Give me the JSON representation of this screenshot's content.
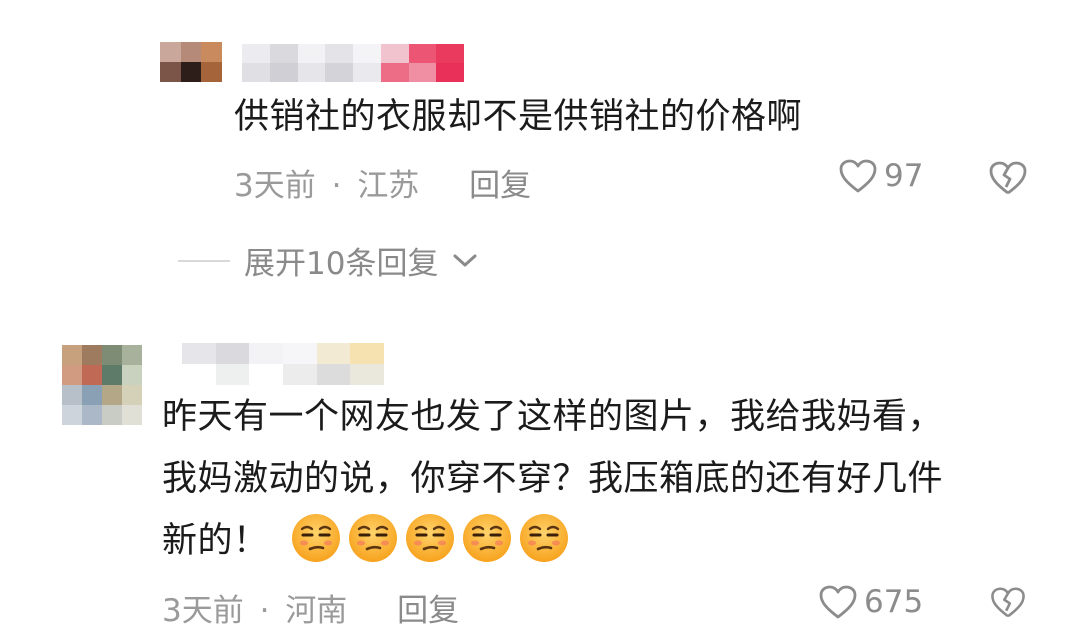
{
  "comments": [
    {
      "text_lines": [
        "供销社的衣服却不是供销社的价格啊"
      ],
      "time": "3天前",
      "separator": "·",
      "location": "江苏",
      "reply_label": "回复",
      "like_count": "97",
      "expand_replies_label": "展开10条回复"
    },
    {
      "text_lines": [
        "昨天有一个网友也发了这样的图片，我给我妈看，",
        "我妈激动的说，你穿不穿？我压箱底的还有好几件",
        "新的！"
      ],
      "emoji_count": 5,
      "time": "3天前",
      "separator": "·",
      "location": "河南",
      "reply_label": "回复",
      "like_count": "675"
    }
  ],
  "colors": {
    "text": "#1b1b1b",
    "meta": "#9a9a9a",
    "icon": "#8c8c8c",
    "emoji_face": "#f7a21d"
  },
  "icons": [
    "heart-outline-icon",
    "broken-heart-icon",
    "chevron-down-icon",
    "smirk-face-emoji"
  ]
}
